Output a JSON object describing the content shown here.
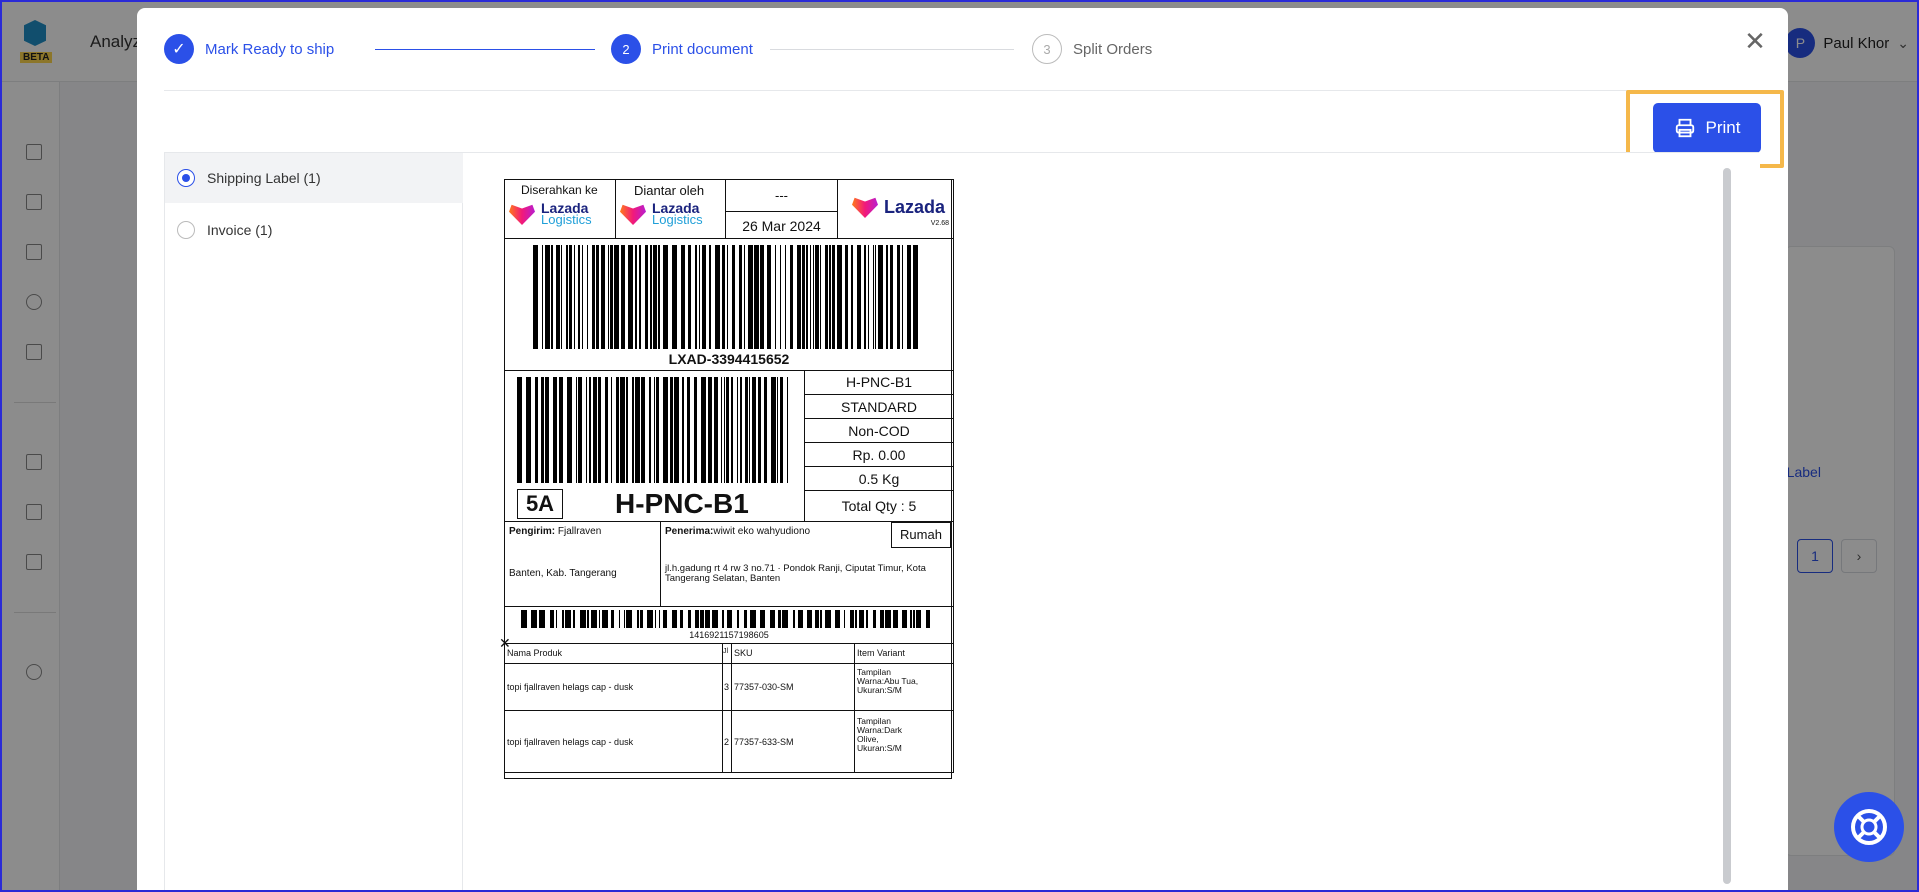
{
  "app": {
    "title": "Analyz",
    "logo_badge": "BETA",
    "user": {
      "initial": "P",
      "name": "Paul Khor"
    },
    "bg_link_text": "g Label",
    "bg_page_current": "1"
  },
  "stepper": {
    "steps": [
      {
        "label": "Mark Ready to ship",
        "state": "done",
        "number": "1"
      },
      {
        "label": "Print document",
        "state": "active",
        "number": "2"
      },
      {
        "label": "Split Orders",
        "state": "todo",
        "number": "3"
      }
    ]
  },
  "toolbar": {
    "print_label": "Print"
  },
  "documents": [
    {
      "label": "Shipping Label (1)",
      "selected": true
    },
    {
      "label": "Invoice (1)",
      "selected": false
    }
  ],
  "label": {
    "handed_to_label": "Diserahkan ke",
    "delivered_by_label": "Diantar oleh",
    "lazada_word": "Lazada",
    "logistics_word": "Logistics",
    "placeholder": "---",
    "date": "26 Mar 2024",
    "version": "V2.68",
    "tracking_number": "LXAD-3394415652",
    "sort_code": "H-PNC-B1",
    "zone_code": "5A",
    "info_rows": [
      "H-PNC-B1",
      "STANDARD",
      "Non-COD",
      "Rp. 0.00",
      "0.5 Kg",
      "Total Qty : 5"
    ],
    "sender_label": "Pengirim:",
    "sender_name": "Fjallraven",
    "sender_region": "Banten, Kab. Tangerang",
    "recipient_label": "Penerima:",
    "recipient_name": "wiwit eko wahyudiono",
    "address_type": "Rumah",
    "recipient_address": "jl.h.gadung rt 4 rw 3 no.71 · Pondok Ranji, Ciputat Timur, Kota Tangerang Selatan, Banten",
    "order_number": "1416921157198605",
    "table_headers": [
      "Nama Produk",
      "Jl",
      "SKU",
      "Item Variant"
    ],
    "table_rows": [
      {
        "product": "topi fjallraven helags cap - dusk",
        "qty": "3",
        "sku": "77357-030-SM",
        "variant": "Tampilan Warna:Abu Tua, Ukuran:S/M"
      },
      {
        "product": "topi fjallraven helags cap - dusk",
        "qty": "2",
        "sku": "77357-633-SM",
        "variant": "Tampilan Warna:Dark Olive, Ukuran:S/M"
      }
    ]
  },
  "colors": {
    "primary": "#2b50e8",
    "highlight": "#f5b84a",
    "overlay": "rgba(0,0,0,0.45)"
  }
}
